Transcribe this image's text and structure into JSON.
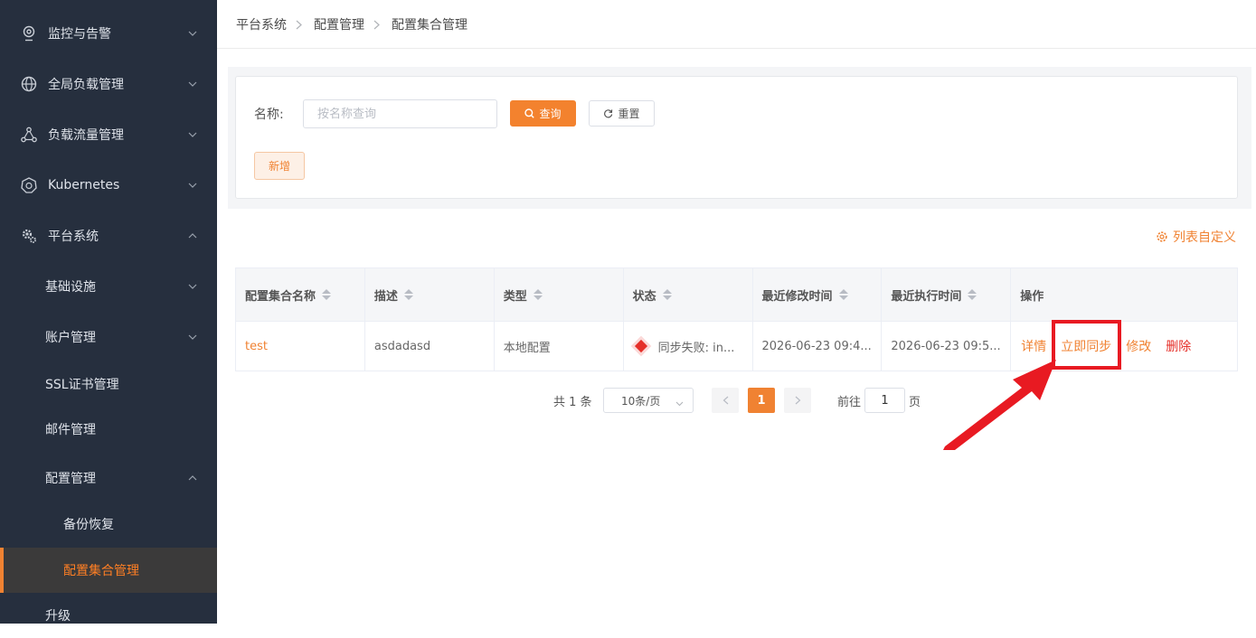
{
  "sidebar": {
    "items": [
      {
        "label": "监控与告警",
        "icon": "monitor-icon",
        "expanded": false
      },
      {
        "label": "全局负载管理",
        "icon": "globe-icon",
        "expanded": false
      },
      {
        "label": "负载流量管理",
        "icon": "flow-icon",
        "expanded": false
      },
      {
        "label": "Kubernetes",
        "icon": "kubernetes-icon",
        "expanded": false
      },
      {
        "label": "平台系统",
        "icon": "gear-icon",
        "expanded": true
      }
    ],
    "sub_items": [
      {
        "label": "基础设施"
      },
      {
        "label": "账户管理"
      },
      {
        "label": "SSL证书管理"
      },
      {
        "label": "邮件管理"
      },
      {
        "label": "配置管理"
      }
    ],
    "sub_sub_items": [
      {
        "label": "备份恢复"
      },
      {
        "label": "配置集合管理"
      }
    ],
    "upgrade_label": "升级"
  },
  "breadcrumb": [
    "平台系统",
    "配置管理",
    "配置集合管理"
  ],
  "filter": {
    "name_label": "名称:",
    "name_placeholder": "按名称查询",
    "query_label": "查询",
    "reset_label": "重置",
    "add_label": "新增"
  },
  "customize_label": "列表自定义",
  "table": {
    "columns": [
      "配置集合名称",
      "描述",
      "类型",
      "状态",
      "最近修改时间",
      "最近执行时间",
      "操作"
    ],
    "rows": [
      {
        "name": "test",
        "description": "asdadasd",
        "type": "本地配置",
        "status": "同步失败: in...",
        "modified": "2026-06-23 09:4...",
        "executed": "2026-06-23 09:5...",
        "actions": [
          "详情",
          "立即同步",
          "修改",
          "删除"
        ]
      }
    ]
  },
  "pagination": {
    "total": "共 1 条",
    "page_size": "10条/页",
    "current": "1",
    "goto_label": "前往",
    "goto_value": "1",
    "page_suffix": "页"
  },
  "colors": {
    "accent": "#f08232",
    "sidebar_bg": "#262f3e",
    "danger": "#e5302a",
    "annotation": "#e81a22"
  }
}
